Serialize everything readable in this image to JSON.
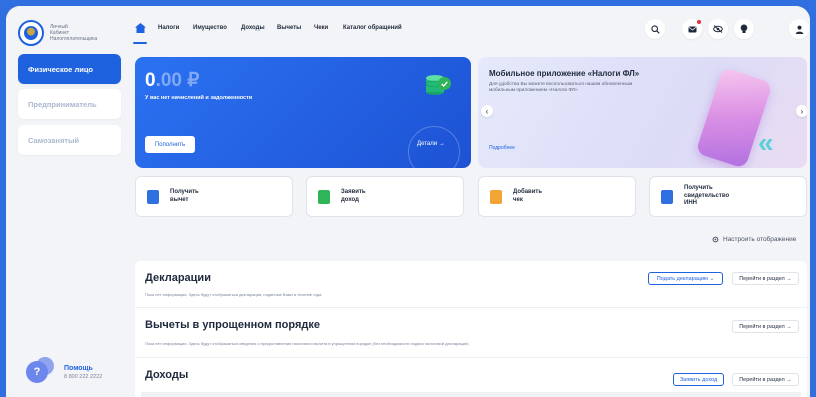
{
  "app": {
    "logo_text": [
      "Личный",
      "Кабинет",
      "Налогоплательщика"
    ]
  },
  "sidebar": {
    "items": [
      {
        "label": "Физическое лицо",
        "active": true
      },
      {
        "label": "Предприниматель",
        "active": false
      },
      {
        "label": "Самозанятый",
        "active": false
      }
    ],
    "help": {
      "title": "Помощь",
      "phone": "8 800 222 2222"
    }
  },
  "nav": {
    "items": [
      "Налоги",
      "Имущество",
      "Доходы",
      "Вычеты",
      "Чеки",
      "Каталог обращений"
    ]
  },
  "balance": {
    "amount_int": "0",
    "amount_cents": ".00 ₽",
    "note": "У вас нет начислений и задолженности",
    "topup_label": "Пополнить",
    "details_label": "Детали →"
  },
  "promo": {
    "title": "Мобильное приложение «Налоги ФЛ»",
    "text": "Для удобства Вы можете воспользоваться нашим обновленным мобильным приложением «Налоги ФЛ»",
    "link": "Подробнее"
  },
  "quick_actions": [
    {
      "line1": "Получить",
      "line2": "вычет",
      "line3": "",
      "icon": "deduction-icon",
      "color": "#2f6fe0"
    },
    {
      "line1": "Заявить",
      "line2": "доход",
      "line3": "",
      "icon": "income-icon",
      "color": "#2fb45a"
    },
    {
      "line1": "Добавить",
      "line2": "чек",
      "line3": "",
      "icon": "receipt-icon",
      "color": "#f2a534"
    },
    {
      "line1": "Получить",
      "line2": "свидетельство",
      "line3": "ИНН",
      "icon": "certificate-icon",
      "color": "#2f6fe0"
    }
  ],
  "configure_label": "Настроить отображение",
  "sections": {
    "declarations": {
      "title": "Декларации",
      "desc": "Пока нет информации. Здесь будут отображаться декларации, поданные Вами в течение года.",
      "primary_btn": "Подать декларацию ⌄",
      "goto_btn": "Перейти в раздел →"
    },
    "deductions": {
      "title": "Вычеты в упрощенном порядке",
      "desc": "Пока нет информации. Здесь будут отображаться сведения о предоставлении налогового вычета в упрощенном порядке (без необходимости подачи налоговой декларации)",
      "goto_btn": "Перейти в раздел →"
    },
    "income": {
      "title": "Доходы",
      "primary_btn": "Заявить доход",
      "goto_btn": "Перейти в раздел →"
    }
  },
  "colors": {
    "accent": "#1f62e0",
    "background": "#2f6fe0",
    "success": "#2fb45a",
    "notice": "#e1344a"
  }
}
